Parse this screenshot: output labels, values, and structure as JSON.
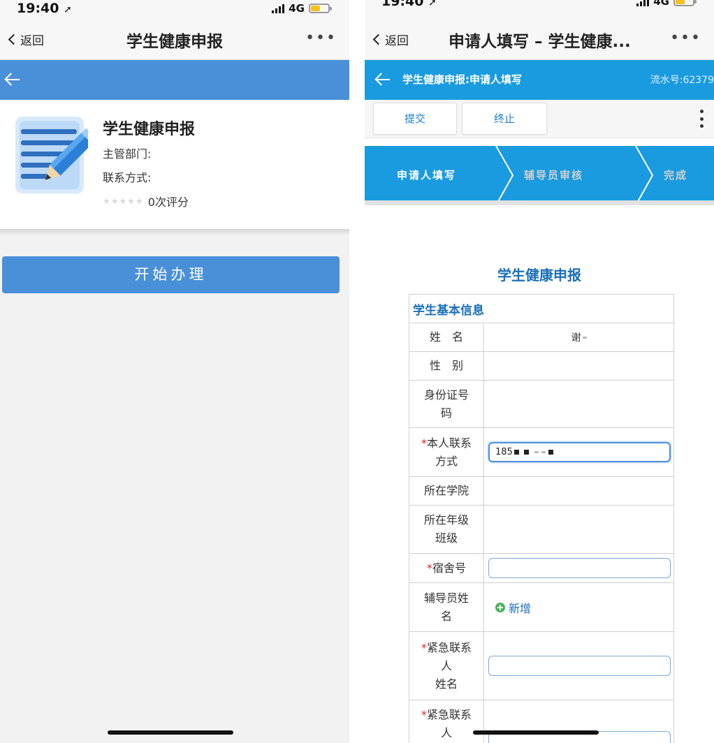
{
  "left": {
    "status": {
      "time": "19:40",
      "network": "4G"
    },
    "nav": {
      "back_label": "返回",
      "title": "学生健康申报",
      "more": "•••"
    },
    "card": {
      "title": "学生健康申报",
      "department_label": "主管部门:",
      "contact_label": "联系方式:",
      "stars": "★★★★★",
      "rating_text": "0次评分"
    },
    "start_button": "开始办理"
  },
  "right": {
    "status": {
      "time": "19:40",
      "network": "4G"
    },
    "nav": {
      "back_label": "返回",
      "title": "申请人填写 – 学生健康...",
      "more": "•••"
    },
    "appbar": {
      "title": "学生健康申报:申请人填写",
      "serial": "流水号:62379"
    },
    "toolbar": {
      "submit": "提交",
      "stop": "终止"
    },
    "steps": [
      {
        "label": "申请人填写",
        "active": true
      },
      {
        "label": "辅导员审核",
        "active": false
      },
      {
        "label": "完成",
        "active": false
      }
    ],
    "form": {
      "title": "学生健康申报",
      "section": "学生基本信息",
      "rows": {
        "name": {
          "label": "姓　名",
          "value": "谢"
        },
        "gender": {
          "label": "性　别",
          "value": ""
        },
        "id_number": {
          "label": "身份证号\n码",
          "value": ""
        },
        "phone": {
          "required": "*",
          "label": "本人联系\n方式",
          "value": "185"
        },
        "college": {
          "label": "所在学院",
          "value": ""
        },
        "grade_class": {
          "label": "所在年级\n班级",
          "value": ""
        },
        "dorm": {
          "required": "*",
          "label": "宿舍号",
          "value": ""
        },
        "counselor": {
          "label": "辅导员姓\n名",
          "add_label": "新增"
        },
        "emergency_name": {
          "required": "*",
          "label": "紧急联系\n人\n姓名",
          "value": ""
        },
        "emergency_next": {
          "required": "*",
          "label": "紧急联系\n人",
          "value": ""
        }
      }
    }
  },
  "colors": {
    "left_accent": "#4a90d9",
    "right_accent": "#1a9bdf",
    "link_blue": "#1b6fba",
    "required_red": "#d9262c",
    "battery": "#f5c21b"
  },
  "icons": [
    "location-arrow-icon",
    "signal-icon",
    "battery-icon",
    "back-chevron-icon",
    "more-dots-icon",
    "arrow-left-icon",
    "document-pencil-icon",
    "star-icon",
    "kebab-menu-icon",
    "plus-circle-icon"
  ]
}
